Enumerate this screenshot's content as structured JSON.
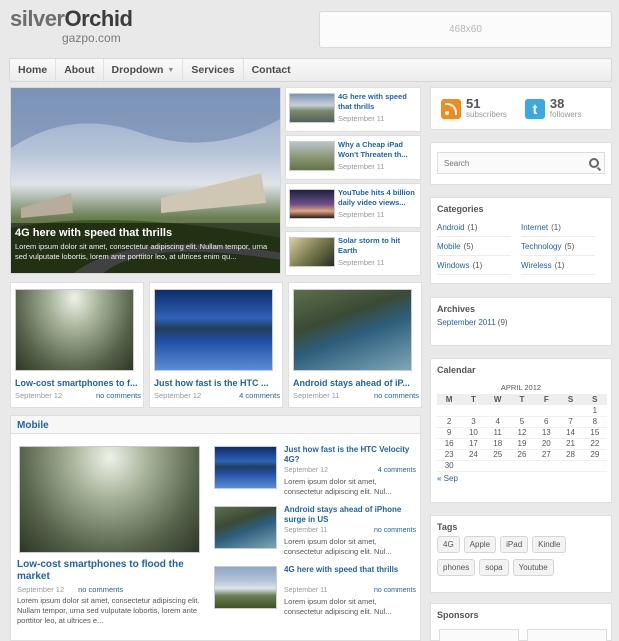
{
  "brand": {
    "title_a": "silver",
    "title_b": "Orchid",
    "subtitle": "gazpo.com"
  },
  "ad_top": "468x60",
  "nav": [
    "Home",
    "About",
    "Dropdown",
    "Services",
    "Contact"
  ],
  "featured": {
    "title": "4G here with speed that thrills",
    "excerpt": "Lorem ipsum dolor sit amet, consectetur adipiscing elit. Nullam tempor, urna sed vulputate lobortis, lorem ante porttitor leo, at ultrices enim qu..."
  },
  "side_posts": [
    {
      "title": "4G here with speed that thrills",
      "date": "September 11"
    },
    {
      "title": "Why a Cheap iPad Won't Threaten th...",
      "date": "September 11"
    },
    {
      "title": "YouTube hits 4 billion daily video views...",
      "date": "September 11"
    },
    {
      "title": "Solar storm to hit Earth",
      "date": "September 11"
    }
  ],
  "cards": [
    {
      "title": "Low-cost smartphones to f...",
      "date": "September 12",
      "comments": "no comments"
    },
    {
      "title": "Just how fast is the HTC ...",
      "date": "September 12",
      "comments": "4 comments"
    },
    {
      "title": "Android stays ahead of iP...",
      "date": "September 11",
      "comments": "no comments"
    }
  ],
  "mobile": {
    "heading": "Mobile",
    "big": {
      "title": "Low-cost smartphones to flood the market",
      "date": "September 12",
      "comments": "no comments",
      "excerpt": "Lorem ipsum dolor sit amet, consectetur adipiscing elit. Nullam tempor, urna sed vulputate lobortis, lorem ante porttitor leo, at ultrices e..."
    },
    "minis": [
      {
        "title": "Just how fast is the HTC Velocity 4G?",
        "date": "September 12",
        "comments": "4 comments",
        "excerpt": "Lorem ipsum dolor sit amet, consectetur adipiscing elit. Nul..."
      },
      {
        "title": "Android stays ahead of iPhone surge in US",
        "date": "September 11",
        "comments": "no comments",
        "excerpt": "Lorem ipsum dolor sit amet, consectetur adipiscing elit. Nul..."
      },
      {
        "title": "4G here with speed that thrills",
        "date": "September 11",
        "comments": "no comments",
        "excerpt": "Lorem ipsum dolor sit amet, consectetur adipiscing elit. Nul..."
      }
    ]
  },
  "social": {
    "rss_count": "51",
    "rss_label": "subscribers",
    "tw_count": "38",
    "tw_label": "followers"
  },
  "search": {
    "placeholder": "Search"
  },
  "categories": {
    "title": "Categories",
    "items": [
      {
        "name": "Android",
        "count": "(1)"
      },
      {
        "name": "Internet",
        "count": "(1)"
      },
      {
        "name": "Mobile",
        "count": "(5)"
      },
      {
        "name": "Technology",
        "count": "(5)"
      },
      {
        "name": "Windows",
        "count": "(1)"
      },
      {
        "name": "Wireless",
        "count": "(1)"
      }
    ]
  },
  "archives": {
    "title": "Archives",
    "item": "September 2011",
    "count": "(9)"
  },
  "calendar": {
    "title": "Calendar",
    "caption": "APRIL 2012",
    "days": [
      "M",
      "T",
      "W",
      "T",
      "F",
      "S",
      "S"
    ],
    "weeks": [
      [
        "",
        "",
        "",
        "",
        "",
        "",
        "1"
      ],
      [
        "2",
        "3",
        "4",
        "5",
        "6",
        "7",
        "8"
      ],
      [
        "9",
        "10",
        "11",
        "12",
        "13",
        "14",
        "15"
      ],
      [
        "16",
        "17",
        "18",
        "19",
        "20",
        "21",
        "22"
      ],
      [
        "23",
        "24",
        "25",
        "26",
        "27",
        "28",
        "29"
      ],
      [
        "30",
        "",
        "",
        "",
        "",
        "",
        ""
      ]
    ],
    "prev": "« Sep"
  },
  "tags": {
    "title": "Tags",
    "items": [
      "4G",
      "Apple",
      "iPad",
      "Kindle",
      "phones",
      "sopa",
      "Youtube"
    ]
  },
  "sponsors": {
    "title": "Sponsors"
  }
}
